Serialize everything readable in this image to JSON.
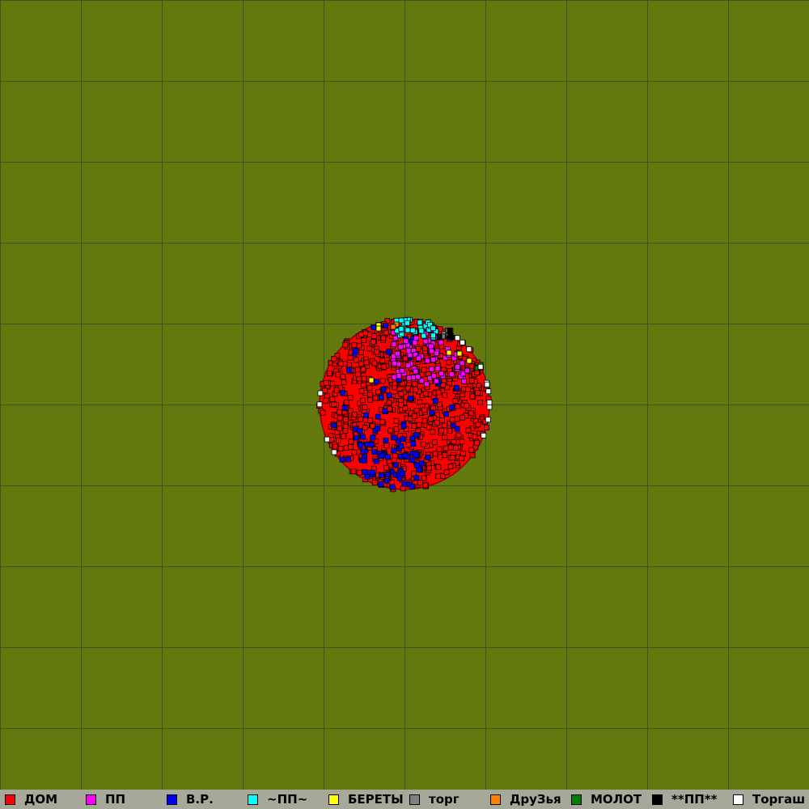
{
  "map": {
    "background_color": "#64790d",
    "grid_color": "#2f5a1a"
  },
  "legend": {
    "items": [
      {
        "label": "ДОМ",
        "color": "#ff0000"
      },
      {
        "label": "ПП",
        "color": "#ff00ff"
      },
      {
        "label": "В.Р.",
        "color": "#0000ff"
      },
      {
        "label": "~ПП~",
        "color": "#00ffff"
      },
      {
        "label": "БЕРЕТЫ",
        "color": "#ffff00"
      },
      {
        "label": "торг",
        "color": "#808080"
      },
      {
        "label": "ДруЗья",
        "color": "#ff8000"
      },
      {
        "label": "МОЛОТ",
        "color": "#008000"
      },
      {
        "label": "**ПП**",
        "color": "#000000"
      },
      {
        "label": "Торгаш",
        "color": "#ffffff"
      }
    ]
  }
}
